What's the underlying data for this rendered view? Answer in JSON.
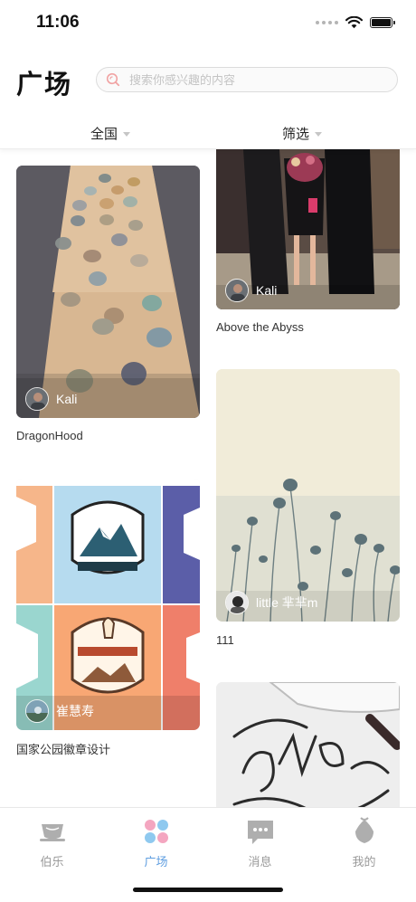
{
  "status_bar": {
    "time": "11:06"
  },
  "header": {
    "title": "广场",
    "search_placeholder": "搜索你感兴趣的内容"
  },
  "filters": {
    "region": "全国",
    "filter": "筛选"
  },
  "posts": [
    {
      "title": "DragonHood",
      "author": "Kali"
    },
    {
      "title": "Above the Abyss",
      "author": "Kali"
    },
    {
      "title": "国家公园徽章设计",
      "author": "崔慧寿"
    },
    {
      "title": "111",
      "author": "little 芈芈m"
    },
    {
      "title": "",
      "author": ""
    }
  ],
  "tab_bar": {
    "tabs": [
      {
        "label": "伯乐",
        "icon": "cup-icon"
      },
      {
        "label": "广场",
        "icon": "four-dots-icon",
        "active": true
      },
      {
        "label": "消息",
        "icon": "message-icon"
      },
      {
        "label": "我的",
        "icon": "profile-icon"
      }
    ]
  },
  "colors": {
    "accent": "#5f9ee0",
    "inactive": "#9a9a9a"
  }
}
